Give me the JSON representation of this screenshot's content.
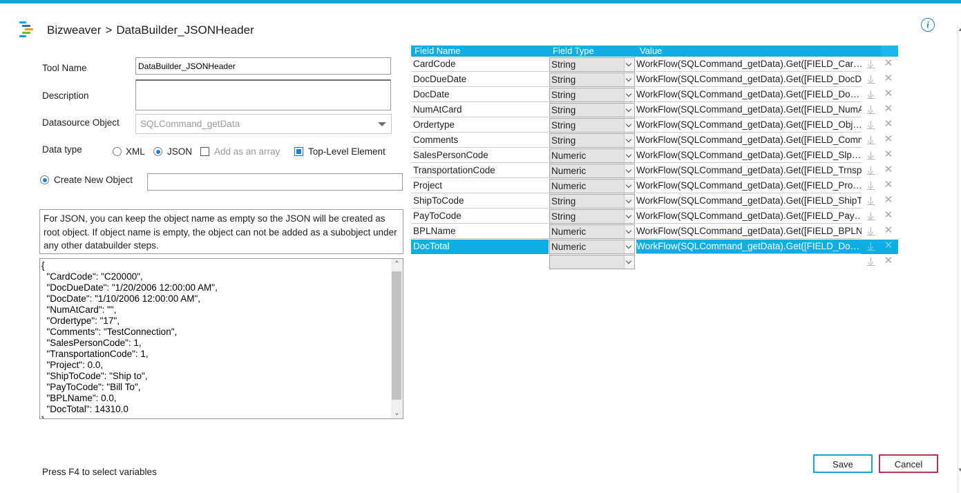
{
  "colors": {
    "accent": "#1ba1d8",
    "grid_header": "#0eaee2",
    "cancel_border": "#b8334f",
    "info": "#1e7fd0"
  },
  "header": {
    "app_name": "Bizweaver",
    "separator": ">",
    "page_title": "DataBuilder_JSONHeader",
    "info_icon": "info-icon"
  },
  "form": {
    "tool_name_label": "Tool Name",
    "tool_name_value": "DataBuilder_JSONHeader",
    "description_label": "Description",
    "description_value": "",
    "datasource_label": "Datasource Object",
    "datasource_value": "SQLCommand_getData",
    "data_type_label": "Data type",
    "data_type_options": [
      {
        "label": "XML",
        "selected": false
      },
      {
        "label": "JSON",
        "selected": true
      }
    ],
    "add_as_array": {
      "label": "Add as an array",
      "checked": false,
      "disabled": true
    },
    "top_level_element": {
      "label": "Top-Level Element",
      "checked": true
    },
    "create_new_object": {
      "label": "Create New Object",
      "selected": true,
      "value": ""
    },
    "note": "For JSON, you can keep the object name as empty so the JSON will be created as root object.  If object name is empty, the object can not be added as a subobject under any other databuilder steps.",
    "json_preview": "{\n  \"CardCode\": \"C20000\",\n  \"DocDueDate\": \"1/20/2006 12:00:00 AM\",\n  \"DocDate\": \"1/10/2006 12:00:00 AM\",\n  \"NumAtCard\": \"\",\n  \"Ordertype\": \"17\",\n  \"Comments\": \"TestConnection\",\n  \"SalesPersonCode\": 1,\n  \"TransportationCode\": 1,\n  \"Project\": 0.0,\n  \"ShipToCode\": \"Ship to\",\n  \"PayToCode\": \"Bill To\",\n  \"BPLName\": 0.0,\n  \"DocTotal\": 14310.0\n}",
    "hint": "Press F4 to select variables"
  },
  "grid": {
    "columns": {
      "name": "Field Name",
      "type": "Field Type",
      "value": "Value"
    },
    "rows": [
      {
        "name": "CardCode",
        "type": "String",
        "value": "WorkFlow(SQLCommand_getData).Get([FIELD_Car…",
        "selected": false
      },
      {
        "name": "DocDueDate",
        "type": "String",
        "value": "WorkFlow(SQLCommand_getData).Get([FIELD_DocDu",
        "selected": false
      },
      {
        "name": "DocDate",
        "type": "String",
        "value": "WorkFlow(SQLCommand_getData).Get([FIELD_Do…",
        "selected": false
      },
      {
        "name": "NumAtCard",
        "type": "String",
        "value": "WorkFlow(SQLCommand_getData).Get([FIELD_NumA",
        "selected": false
      },
      {
        "name": "Ordertype",
        "type": "String",
        "value": "WorkFlow(SQLCommand_getData).Get([FIELD_Obj…",
        "selected": false
      },
      {
        "name": "Comments",
        "type": "String",
        "value": "WorkFlow(SQLCommand_getData).Get([FIELD_Comm",
        "selected": false
      },
      {
        "name": "SalesPersonCode",
        "type": "Numeric",
        "value": "WorkFlow(SQLCommand_getData).Get([FIELD_Slp…",
        "selected": false
      },
      {
        "name": "TransportationCode",
        "type": "Numeric",
        "value": "WorkFlow(SQLCommand_getData).Get([FIELD_Trnsp(",
        "selected": false
      },
      {
        "name": "Project",
        "type": "Numeric",
        "value": "WorkFlow(SQLCommand_getData).Get([FIELD_Pro…",
        "selected": false
      },
      {
        "name": "ShipToCode",
        "type": "String",
        "value": "WorkFlow(SQLCommand_getData).Get([FIELD_ShipTo",
        "selected": false
      },
      {
        "name": "PayToCode",
        "type": "String",
        "value": "WorkFlow(SQLCommand_getData).Get([FIELD_Pay…",
        "selected": false
      },
      {
        "name": "BPLName",
        "type": "Numeric",
        "value": "WorkFlow(SQLCommand_getData).Get([FIELD_BPLNa",
        "selected": false
      },
      {
        "name": "DocTotal",
        "type": "Numeric",
        "value": "WorkFlow(SQLCommand_getData).Get([FIELD_Do…",
        "selected": true
      },
      {
        "name": "",
        "type": "",
        "value": "",
        "selected": false,
        "empty": true
      }
    ],
    "download_icon": "download-icon",
    "delete_icon": "close-icon"
  },
  "buttons": {
    "save": "Save",
    "cancel": "Cancel"
  }
}
